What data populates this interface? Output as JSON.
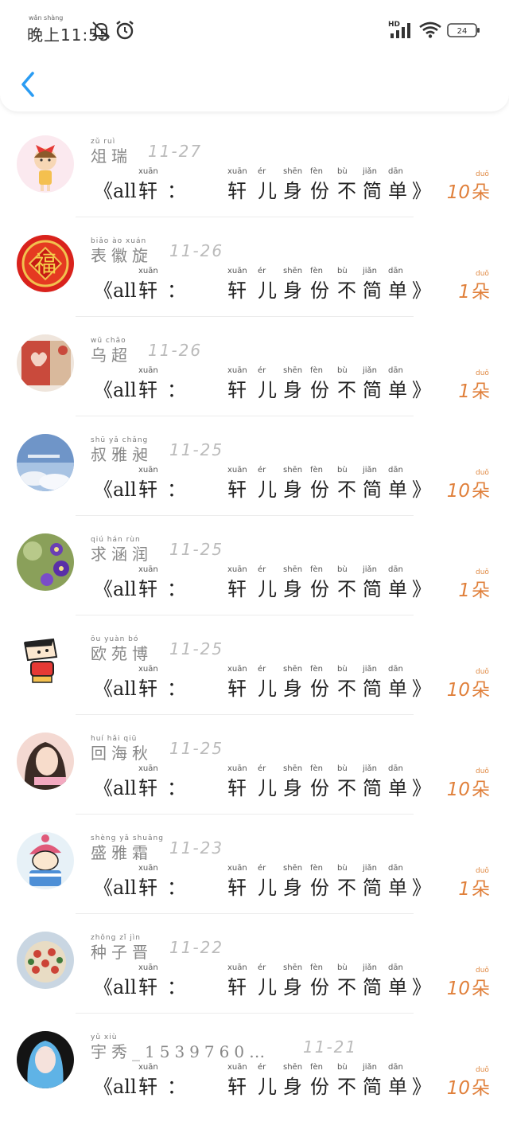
{
  "status_bar": {
    "time": "晚上11:55",
    "time_pinyin": "wǎn shàng",
    "network_label": "HD",
    "battery": "24",
    "icons": [
      "mute-bell-icon",
      "alarm-icon",
      "signal-icon",
      "wifi-icon",
      "battery-icon"
    ]
  },
  "header": {
    "back_icon": "chevron-left-icon",
    "accent": "#2a9cf3"
  },
  "gift_accent": "#e0803b",
  "message": {
    "prefix": "《all",
    "chars": [
      "轩",
      "：",
      "轩",
      "儿",
      "身",
      "份",
      "不",
      "简",
      "单",
      "》"
    ],
    "pinyin": [
      "xuān",
      "",
      "xuān",
      "ér",
      "shēn",
      "fèn",
      "bù",
      "jiǎn",
      "dān",
      ""
    ]
  },
  "unit": {
    "char": "朵",
    "pinyin": "duǒ"
  },
  "items": [
    {
      "name": "俎瑞",
      "pinyin": "zǔ ruì",
      "date": "11-27",
      "count": "10",
      "avatar": "girl-bow-avatar"
    },
    {
      "name": "表徽旋",
      "pinyin": "biǎo ào xuán",
      "date": "11-26",
      "count": "1",
      "avatar": "fu-character-avatar"
    },
    {
      "name": "乌超",
      "pinyin": "wū chāo",
      "date": "11-26",
      "count": "1",
      "avatar": "heart-box-avatar"
    },
    {
      "name": "叔雅昶",
      "pinyin": "shū yǎ chǎng",
      "date": "11-25",
      "count": "10",
      "avatar": "sky-clouds-avatar"
    },
    {
      "name": "求涵润",
      "pinyin": "qiú hán rùn",
      "date": "11-25",
      "count": "1",
      "avatar": "purple-flowers-avatar"
    },
    {
      "name": "欧苑博",
      "pinyin": "ōu yuàn bó",
      "date": "11-25",
      "count": "10",
      "avatar": "cartoon-boy-avatar"
    },
    {
      "name": "回海秋",
      "pinyin": "huí hǎi qiū",
      "date": "11-25",
      "count": "10",
      "avatar": "girl-selfie-avatar"
    },
    {
      "name": "盛雅霜",
      "pinyin": "shèng yǎ shuāng",
      "date": "11-23",
      "count": "1",
      "avatar": "cartoon-hat-avatar"
    },
    {
      "name": "种子晋",
      "pinyin": "zhǒng zǐ jìn",
      "date": "11-22",
      "count": "10",
      "avatar": "flower-ball-avatar"
    },
    {
      "name": "宇秀_1539760…",
      "pinyin": "yǔ xiù",
      "date": "11-21",
      "count": "10",
      "avatar": "blue-hair-girl-avatar"
    }
  ]
}
